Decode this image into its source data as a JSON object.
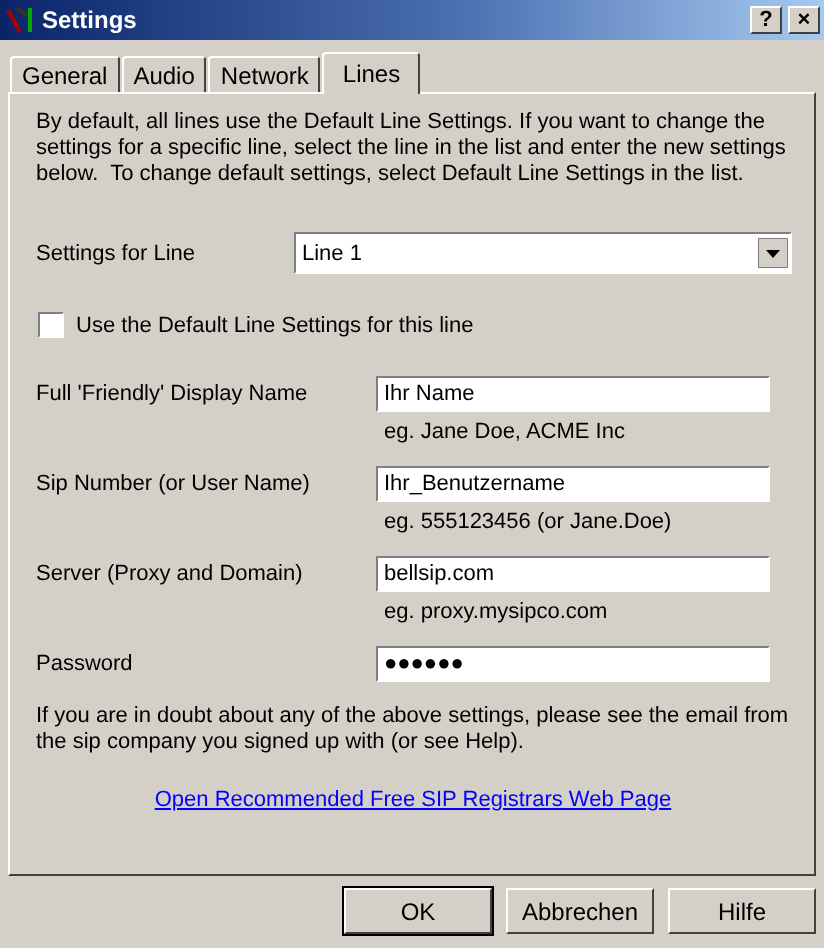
{
  "window": {
    "title": "Settings",
    "buttons": [
      "?",
      "×"
    ]
  },
  "tabs": [
    {
      "label": "General",
      "selected": false
    },
    {
      "label": "Audio",
      "selected": false
    },
    {
      "label": "Network",
      "selected": false
    },
    {
      "label": "Lines",
      "selected": true
    }
  ],
  "intro": "By default, all lines use the Default Line Settings. If you want to change the settings for a specific line, select the line in the list and enter the new settings below.  To change default settings, select Default Line Settings in the list.",
  "line_select": {
    "label": "Settings for Line",
    "value": "Line 1"
  },
  "use_default": {
    "label": "Use the Default Line Settings for this line",
    "checked": false
  },
  "fields": [
    {
      "label": "Full 'Friendly' Display Name",
      "value": "Ihr Name",
      "hint": "eg.  Jane Doe, ACME Inc"
    },
    {
      "label": "Sip Number (or User Name)",
      "value": "Ihr_Benutzername",
      "hint": "eg.  555123456 (or Jane.Doe)"
    },
    {
      "label": "Server (Proxy and Domain)",
      "value": "bellsip.com",
      "hint": "eg.  proxy.mysipco.com"
    },
    {
      "label": "Password",
      "value": "●●●●●●"
    }
  ],
  "help_text": "If you are in doubt about any of the above settings, please see the email from the sip company you signed up with (or see Help).",
  "link": "Open Recommended Free SIP Registrars Web Page",
  "buttons": [
    {
      "label": "OK",
      "default": true
    },
    {
      "label": "Abbrechen",
      "default": false
    },
    {
      "label": "Hilfe",
      "default": false
    }
  ]
}
